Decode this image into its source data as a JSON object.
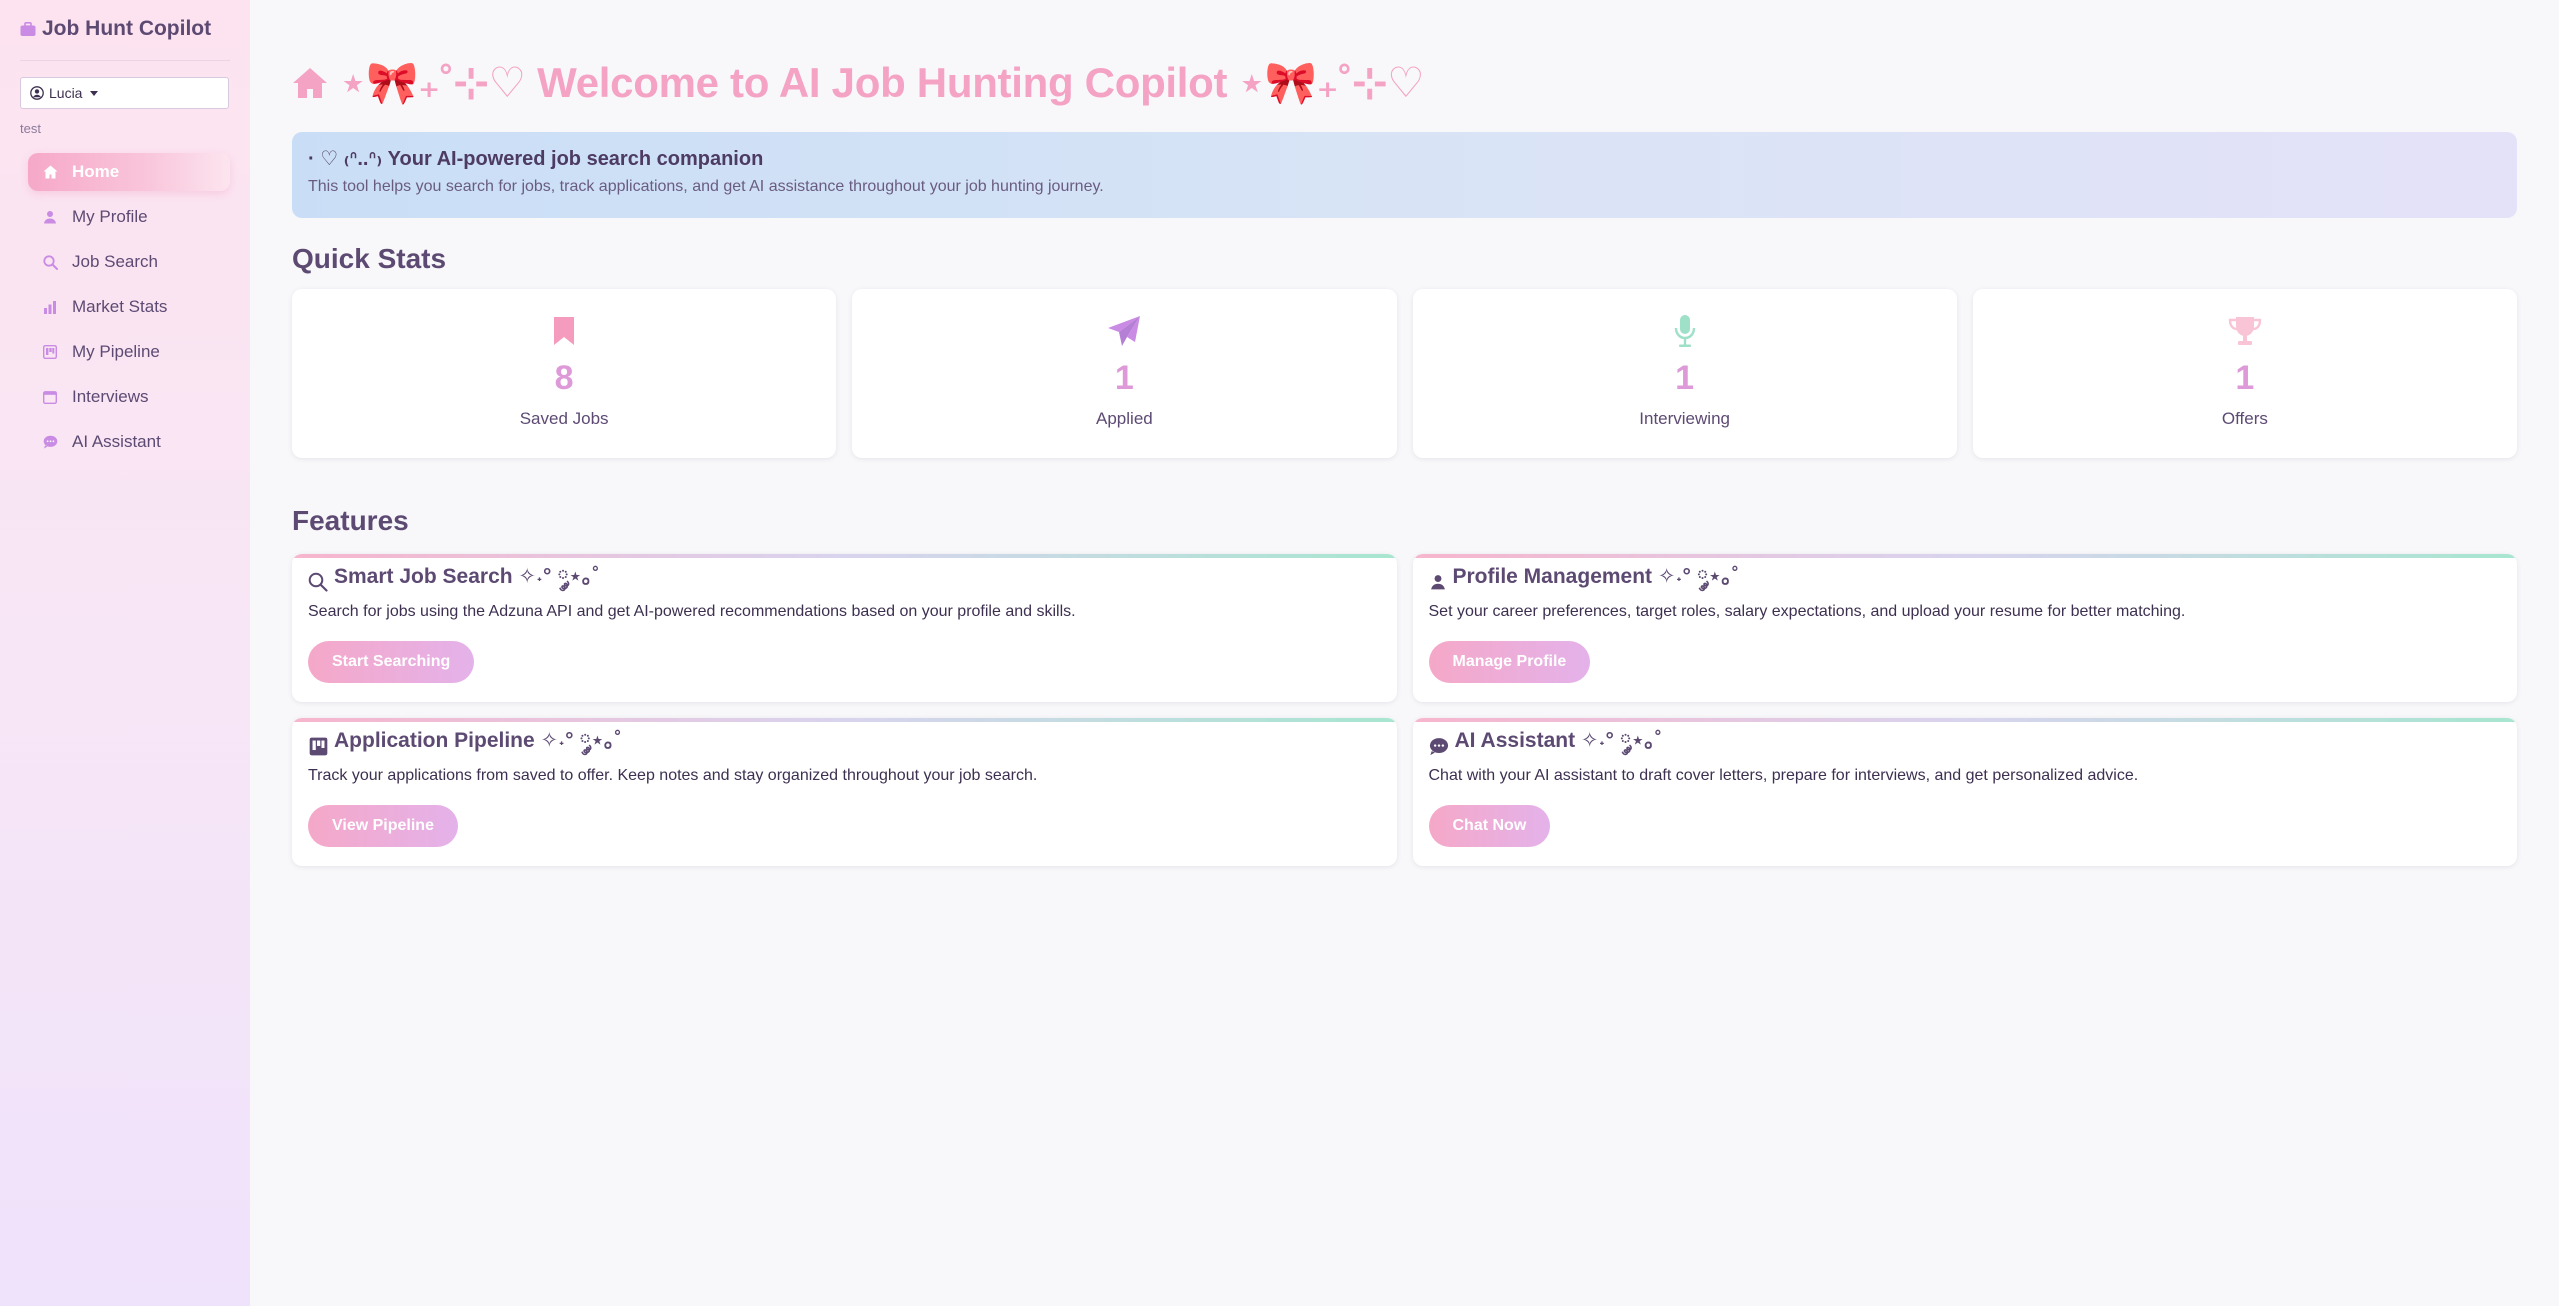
{
  "app": {
    "brand": "Job Hunt Copilot"
  },
  "user": {
    "selected": "Lucia",
    "subtitle": "test"
  },
  "sidebar": {
    "items": [
      {
        "label": "Home",
        "icon": "home-icon",
        "active": true
      },
      {
        "label": "My Profile",
        "icon": "person-icon"
      },
      {
        "label": "Job Search",
        "icon": "search-icon"
      },
      {
        "label": "Market Stats",
        "icon": "bar-chart-icon"
      },
      {
        "label": "My Pipeline",
        "icon": "kanban-icon"
      },
      {
        "label": "Interviews",
        "icon": "calendar-icon"
      },
      {
        "label": "AI Assistant",
        "icon": "chat-icon"
      }
    ]
  },
  "hero": {
    "title": "⋆🎀₊˚⊹♡ Welcome to AI Job Hunting Copilot ⋆🎀₊˚⊹♡"
  },
  "banner": {
    "title": "· ♡ ₍ᐢ..ᐢ₎ Your AI-powered job search companion",
    "text": "This tool helps you search for jobs, track applications, and get AI assistance throughout your job hunting journey."
  },
  "quick_stats": {
    "title": "Quick Stats",
    "items": [
      {
        "value": "8",
        "label": "Saved Jobs",
        "icon": "bookmark-icon",
        "color": "#f59bbd"
      },
      {
        "value": "1",
        "label": "Applied",
        "icon": "paper-plane-icon",
        "color": "#c98be3"
      },
      {
        "value": "1",
        "label": "Interviewing",
        "icon": "microphone-icon",
        "color": "#9ee0c8"
      },
      {
        "value": "1",
        "label": "Offers",
        "icon": "trophy-icon",
        "color": "#f9c4d6"
      }
    ]
  },
  "features": {
    "title": "Features",
    "items": [
      {
        "title": "Smart Job Search ✧˖° ༘⋆｡˚",
        "desc": "Search for jobs using the Adzuna API and get AI-powered recommendations based on your profile and skills.",
        "button": "Start Searching",
        "icon": "search-icon"
      },
      {
        "title": "Profile Management ✧˖° ༘⋆｡˚",
        "desc": "Set your career preferences, target roles, salary expectations, and upload your resume for better matching.",
        "button": "Manage Profile",
        "icon": "person-icon"
      },
      {
        "title": "Application Pipeline ✧˖° ༘⋆｡˚",
        "desc": "Track your applications from saved to offer. Keep notes and stay organized throughout your job search.",
        "button": "View Pipeline",
        "icon": "kanban-icon"
      },
      {
        "title": "AI Assistant ✧˖° ༘⋆｡˚",
        "desc": "Chat with your AI assistant to draft cover letters, prepare for interviews, and get personalized advice.",
        "button": "Chat Now",
        "icon": "chat-icon"
      }
    ]
  },
  "colors": {
    "accent_pink": "#f4a3c4",
    "text_purple": "#5d4a73",
    "stat_value": "#de9ad8"
  }
}
